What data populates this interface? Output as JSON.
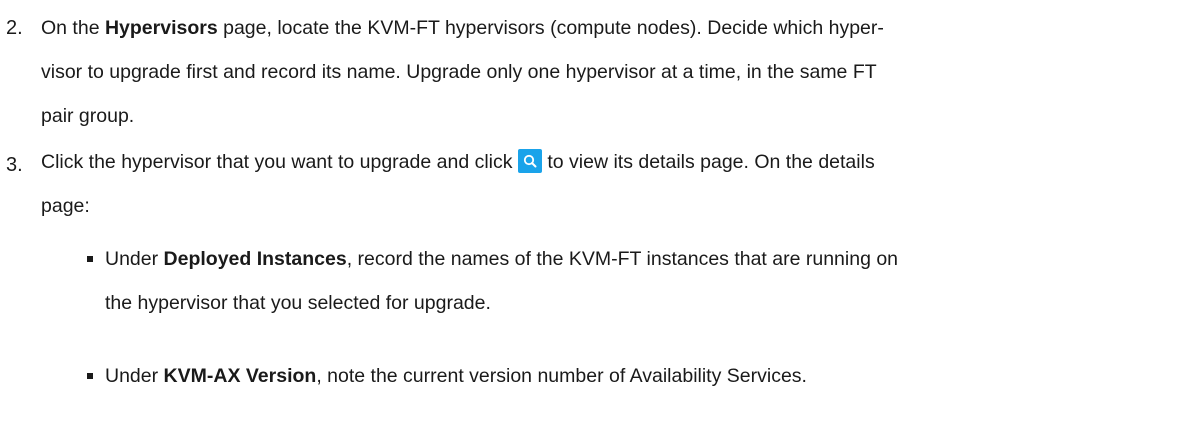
{
  "step2": {
    "number": "2.",
    "line1_prefix": "On the ",
    "line1_bold": "Hypervisors",
    "line1_suffix": " page, locate the KVM-FT hypervisors (compute nodes). Decide which hyper-",
    "line2": "visor to upgrade first and record its name. Upgrade only one hypervisor at a time, in the same FT",
    "line3": "pair group."
  },
  "step3": {
    "number": "3.",
    "line1_prefix": "Click the hypervisor that you want to upgrade and click ",
    "line1_icon": "search-icon",
    "line1_suffix": " to view its details page. On the details",
    "line2": "page:",
    "icon_color": "#1aa3ea",
    "bullets": [
      {
        "prefix": "Under ",
        "bold": "Deployed Instances",
        "suffix": ", record the names of the KVM-FT instances that are running on",
        "line2": "the hypervisor that you selected for upgrade."
      },
      {
        "prefix": "Under ",
        "bold": "KVM-AX Version",
        "suffix": ", note the current version number of Availability Services.",
        "line2": ""
      }
    ]
  }
}
